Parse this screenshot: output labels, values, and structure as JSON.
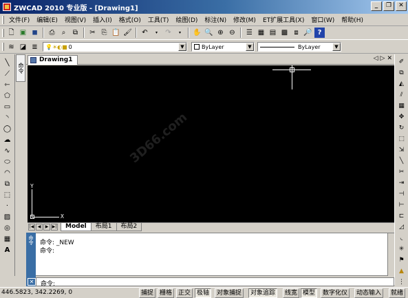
{
  "window": {
    "title": "ZWCAD 2010 专业版 - [Drawing1]"
  },
  "menu": [
    "文件(F)",
    "编辑(E)",
    "视图(V)",
    "插入(I)",
    "格式(O)",
    "工具(T)",
    "绘图(D)",
    "标注(N)",
    "修改(M)",
    "ET扩展工具(X)",
    "窗口(W)",
    "帮助(H)"
  ],
  "toolbar2": {
    "layer_value": "0",
    "color_value": "ByLayer",
    "linetype_value": "ByLayer"
  },
  "side_tab_label": "命令",
  "document": {
    "tab_label": "Drawing1"
  },
  "canvas": {
    "ucs_y": "Y",
    "ucs_x": "X",
    "watermark": "3D66.com"
  },
  "layout_tabs": [
    "Model",
    "布局1",
    "布局2"
  ],
  "command": {
    "side_label": "命令",
    "lines": [
      "命令: _NEW",
      "命令:"
    ],
    "prompt": "命令:"
  },
  "status": {
    "coords": "446.5823, 342.2269, 0",
    "buttons": [
      "捕捉",
      "栅格",
      "正交",
      "极轴",
      "对象捕捉",
      "对象追踪",
      "线宽",
      "模型",
      "数字化仪",
      "动态输入",
      "就绪"
    ]
  }
}
